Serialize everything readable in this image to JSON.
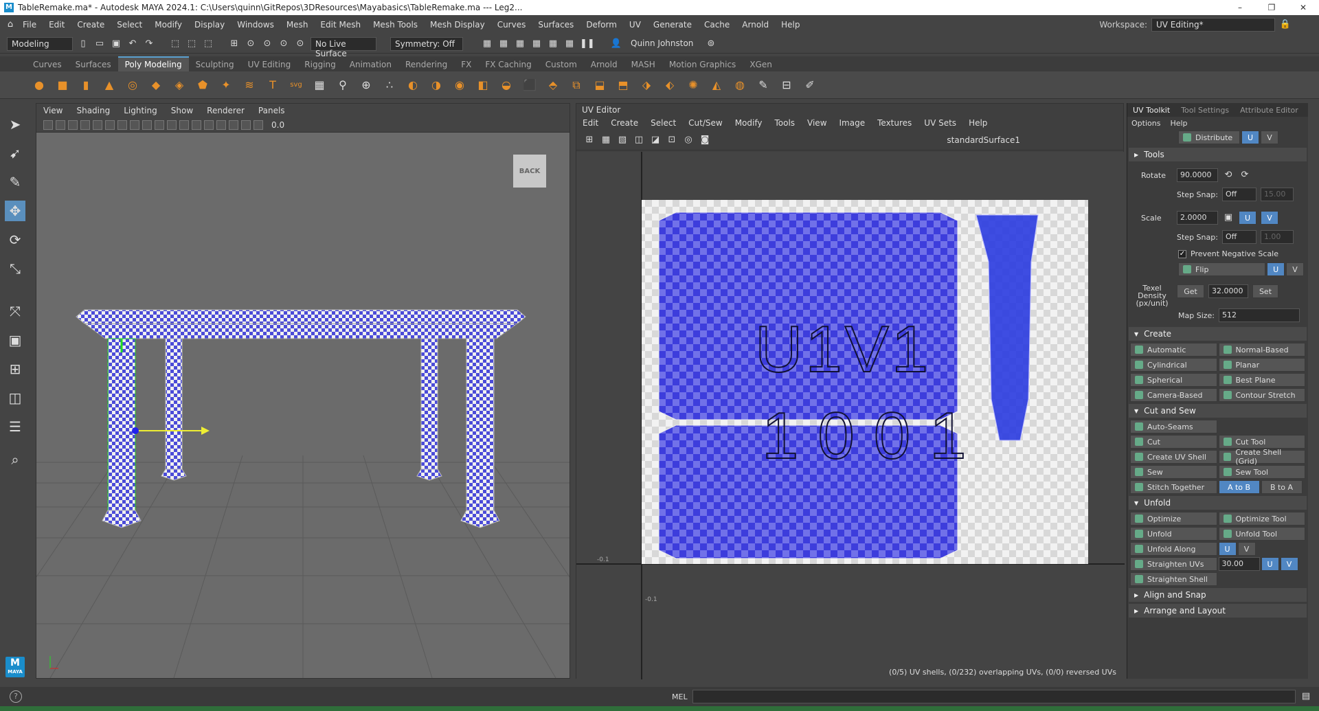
{
  "window": {
    "title": "TableRemake.ma* - Autodesk MAYA 2024.1: C:\\Users\\quinn\\GitRepos\\3DResources\\Mayabasics\\TableRemake.ma --- Leg2..."
  },
  "menubar": {
    "items": [
      "File",
      "Edit",
      "Create",
      "Select",
      "Modify",
      "Display",
      "Windows",
      "Mesh",
      "Edit Mesh",
      "Mesh Tools",
      "Mesh Display",
      "Curves",
      "Surfaces",
      "Deform",
      "UV",
      "Generate",
      "Cache",
      "Arnold",
      "Help"
    ],
    "workspace_label": "Workspace:",
    "workspace_value": "UV Editing*"
  },
  "statusline": {
    "menuset": "Modeling",
    "live_surface": "No Live Surface",
    "symmetry": "Symmetry: Off",
    "user": "Quinn Johnston"
  },
  "shelf": {
    "tabs": [
      "Curves",
      "Surfaces",
      "Poly Modeling",
      "Sculpting",
      "UV Editing",
      "Rigging",
      "Animation",
      "Rendering",
      "FX",
      "FX Caching",
      "Custom",
      "Arnold",
      "MASH",
      "Motion Graphics",
      "XGen"
    ],
    "active_tab": "Poly Modeling"
  },
  "viewport": {
    "menu": [
      "View",
      "Shading",
      "Lighting",
      "Show",
      "Renderer",
      "Panels"
    ],
    "back_label": "BACK",
    "near_clip": "0.0"
  },
  "uv_editor": {
    "title": "UV Editor",
    "menu": [
      "Edit",
      "Create",
      "Select",
      "Cut/Sew",
      "Modify",
      "Tools",
      "View",
      "Image",
      "Textures",
      "UV Sets",
      "Help"
    ],
    "shader": "standardSurface1",
    "udim_text_1": "U1V1",
    "udim_text_2": "1001",
    "axis_x_label": "-0.1",
    "axis_y_label": "-0.1",
    "status": "(0/5) UV shells, (0/232) overlapping UVs, (0/0) reversed UVs"
  },
  "toolkit": {
    "tabs": [
      "UV Toolkit",
      "Tool Settings",
      "Attribute Editor"
    ],
    "active_tab": "UV Toolkit",
    "submenu": [
      "Options",
      "Help"
    ],
    "distribute": "Distribute",
    "u": "U",
    "v": "V",
    "tools_section": "Tools",
    "rotate_label": "Rotate",
    "rotate_value": "90.0000",
    "step_snap_label": "Step Snap:",
    "step_snap_value": "Off",
    "rotate_step": "15.00",
    "scale_label": "Scale",
    "scale_value": "2.0000",
    "scale_step": "1.00",
    "prevent_negative": "Prevent Negative Scale",
    "flip": "Flip",
    "texel_label": "Texel Density (px/unit)",
    "get": "Get",
    "texel_value": "32.0000",
    "set": "Set",
    "map_size_label": "Map Size:",
    "map_size": "512",
    "create_section": "Create",
    "create_buttons": [
      "Automatic",
      "Normal-Based",
      "Cylindrical",
      "Planar",
      "Spherical",
      "Best Plane",
      "Camera-Based",
      "Contour Stretch"
    ],
    "cut_sew_section": "Cut and Sew",
    "auto_seams": "Auto-Seams",
    "cut_buttons": [
      "Cut",
      "Cut Tool",
      "Create UV Shell",
      "Create Shell (Grid)",
      "Sew",
      "Sew Tool"
    ],
    "stitch_together": "Stitch Together",
    "a_to_b": "A to B",
    "b_to_a": "B to A",
    "unfold_section": "Unfold",
    "unfold_buttons": [
      "Optimize",
      "Optimize Tool",
      "Unfold",
      "Unfold Tool"
    ],
    "unfold_along": "Unfold Along",
    "straighten_uvs": "Straighten UVs",
    "straighten_value": "30.00",
    "straighten_shell": "Straighten Shell",
    "align_section": "Align and Snap",
    "arrange_section": "Arrange and Layout"
  },
  "cmdline": {
    "mel": "MEL",
    "help": "?"
  },
  "logo": {
    "letter": "M",
    "text": "MAYA"
  }
}
